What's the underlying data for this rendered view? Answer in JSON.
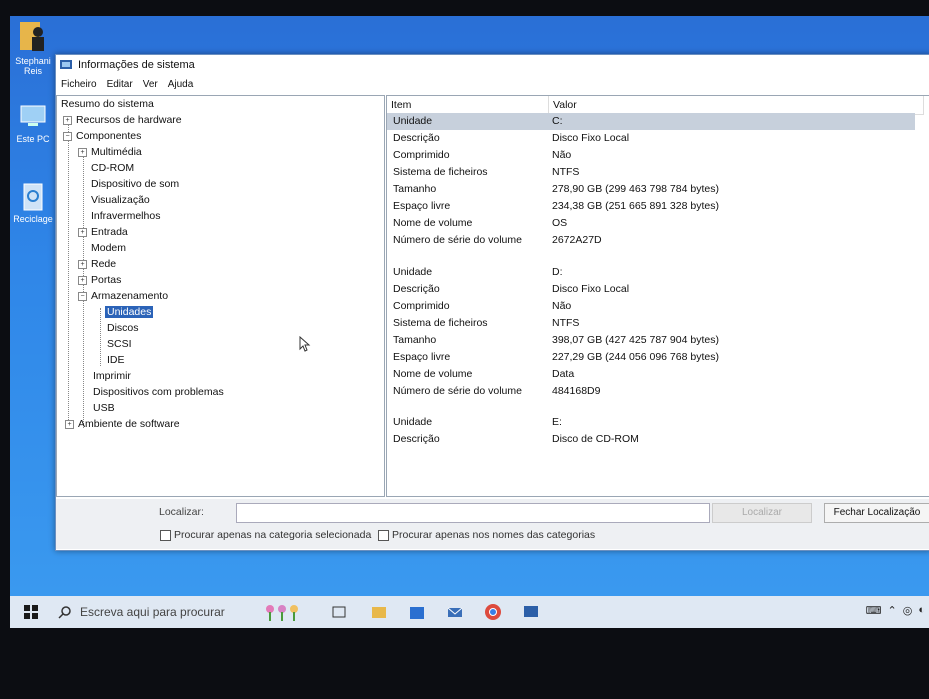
{
  "window": {
    "title": "Informações de sistema"
  },
  "menu": [
    "Ficheiro",
    "Editar",
    "Ver",
    "Ajuda"
  ],
  "desktop_icons": [
    {
      "label_line1": "Stephani",
      "label_line2": "Reis"
    },
    {
      "label_line1": "Este PC",
      "label_line2": ""
    },
    {
      "label_line1": "Reciclage",
      "label_line2": ""
    }
  ],
  "tree": {
    "root": "Resumo do sistema",
    "hardware": "Recursos de hardware",
    "components": "Componentes",
    "items": {
      "multimedia": "Multimédia",
      "cdrom": "CD-ROM",
      "sound": "Dispositivo de som",
      "display": "Visualização",
      "infrared": "Infravermelhos",
      "input": "Entrada",
      "modem": "Modem",
      "network": "Rede",
      "ports": "Portas",
      "storage": "Armazenamento",
      "drives": "Unidades",
      "disks": "Discos",
      "scsi": "SCSI",
      "ide": "IDE",
      "print": "Imprimir",
      "problem": "Dispositivos com problemas",
      "usb": "USB"
    },
    "software": "Ambiente de software"
  },
  "table": {
    "headers": {
      "item": "Item",
      "value": "Valor"
    },
    "rows": [
      {
        "k": "Unidade",
        "v": "C:"
      },
      {
        "k": "Descrição",
        "v": "Disco Fixo Local"
      },
      {
        "k": "Comprimido",
        "v": "Não"
      },
      {
        "k": "Sistema de ficheiros",
        "v": "NTFS"
      },
      {
        "k": "Tamanho",
        "v": "278,90 GB (299 463 798 784 bytes)"
      },
      {
        "k": "Espaço livre",
        "v": "234,38 GB (251 665 891 328 bytes)"
      },
      {
        "k": "Nome de volume",
        "v": "OS"
      },
      {
        "k": "Número de série do volume",
        "v": "2672A27D"
      },
      {
        "k": "Unidade",
        "v": "D:"
      },
      {
        "k": "Descrição",
        "v": "Disco Fixo Local"
      },
      {
        "k": "Comprimido",
        "v": "Não"
      },
      {
        "k": "Sistema de ficheiros",
        "v": "NTFS"
      },
      {
        "k": "Tamanho",
        "v": "398,07 GB (427 425 787 904 bytes)"
      },
      {
        "k": "Espaço livre",
        "v": "227,29 GB (244 056 096 768 bytes)"
      },
      {
        "k": "Nome de volume",
        "v": "Data"
      },
      {
        "k": "Número de série do volume",
        "v": "484168D9"
      },
      {
        "k": "Unidade",
        "v": "E:"
      },
      {
        "k": "Descrição",
        "v": "Disco de CD-ROM"
      }
    ]
  },
  "find": {
    "label": "Localizar:",
    "find_button": "Localizar",
    "close_button": "Fechar Localização",
    "option_category": "Procurar apenas na categoria selecionada",
    "option_names": "Procurar apenas nos nomes das categorias"
  },
  "taskbar": {
    "search_placeholder": "Escreva aqui para procurar"
  }
}
